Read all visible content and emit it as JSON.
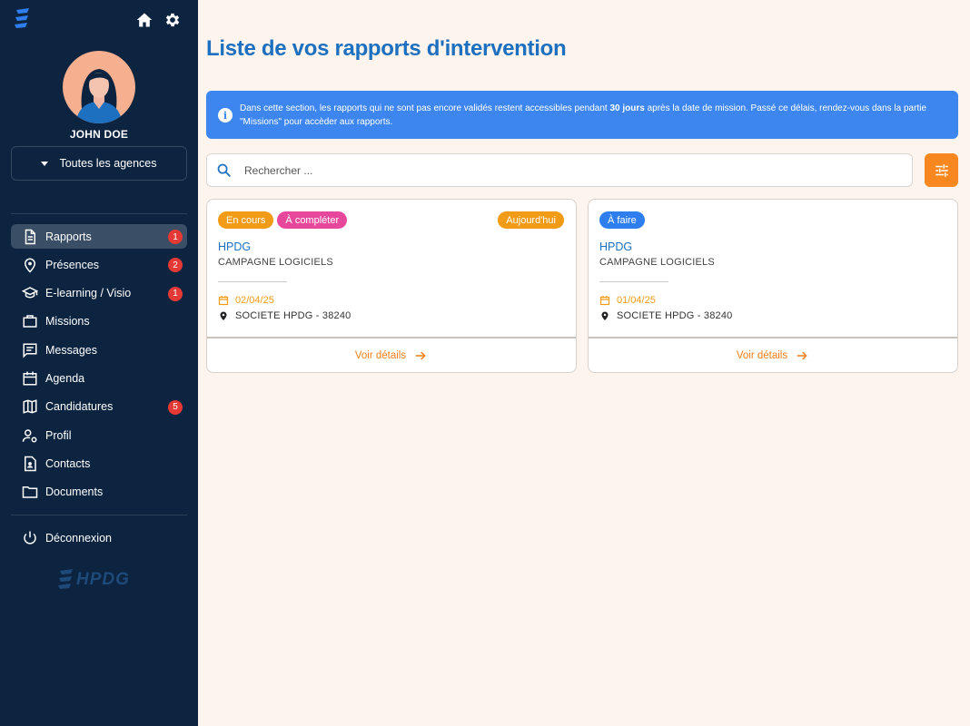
{
  "sidebar": {
    "user_name": "JOHN DOE",
    "agency_select": "Toutes les agences",
    "items": [
      {
        "label": "Rapports",
        "icon": "document-icon",
        "badge": "1",
        "active": true
      },
      {
        "label": "Présences",
        "icon": "location-pin-icon",
        "badge": "2"
      },
      {
        "label": "E-learning / Visio",
        "icon": "graduation-cap-icon",
        "badge": "1"
      },
      {
        "label": "Missions",
        "icon": "briefcase-icon"
      },
      {
        "label": "Messages",
        "icon": "message-icon"
      },
      {
        "label": "Agenda",
        "icon": "calendar-icon"
      },
      {
        "label": "Candidatures",
        "icon": "map-icon",
        "badge": "5"
      },
      {
        "label": "Profil",
        "icon": "user-gear-icon"
      },
      {
        "label": "Contacts",
        "icon": "contact-card-icon"
      },
      {
        "label": "Documents",
        "icon": "folder-icon"
      }
    ],
    "logout_label": "Déconnexion",
    "brand": "HPDG"
  },
  "main": {
    "title": "Liste de vos rapports d'intervention",
    "info": {
      "before": "Dans cette section, les rapports qui ne sont pas encore validés restent accessibles pendant ",
      "bold": "30 jours",
      "after": " après la date de mission. Passé ce délais, rendez-vous dans la partie \"Missions\" pour accèder aux rapports."
    },
    "search_placeholder": "Rechercher ...",
    "cards": [
      {
        "chips": [
          "En cours",
          "À compléter"
        ],
        "right_chip": "Aujourd'hui",
        "title": "HPDG",
        "subtitle": "CAMPAGNE LOGICIELS",
        "date": "02/04/25",
        "place": "SOCIETE HPDG - 38240",
        "action": "Voir détails"
      },
      {
        "chips": [
          "À faire"
        ],
        "title": "HPDG",
        "subtitle": "CAMPAGNE LOGICIELS",
        "date": "01/04/25",
        "place": "SOCIETE HPDG - 38240",
        "action": "Voir détails"
      }
    ]
  },
  "colors": {
    "sidebar_bg": "#0d2440",
    "page_bg": "#fdf4ee",
    "title_blue": "#1d6fbf",
    "info_blue": "#3d86f0",
    "accent_orange": "#f7871e",
    "badge_red": "#e53935",
    "chip_pink": "#e8489c"
  }
}
